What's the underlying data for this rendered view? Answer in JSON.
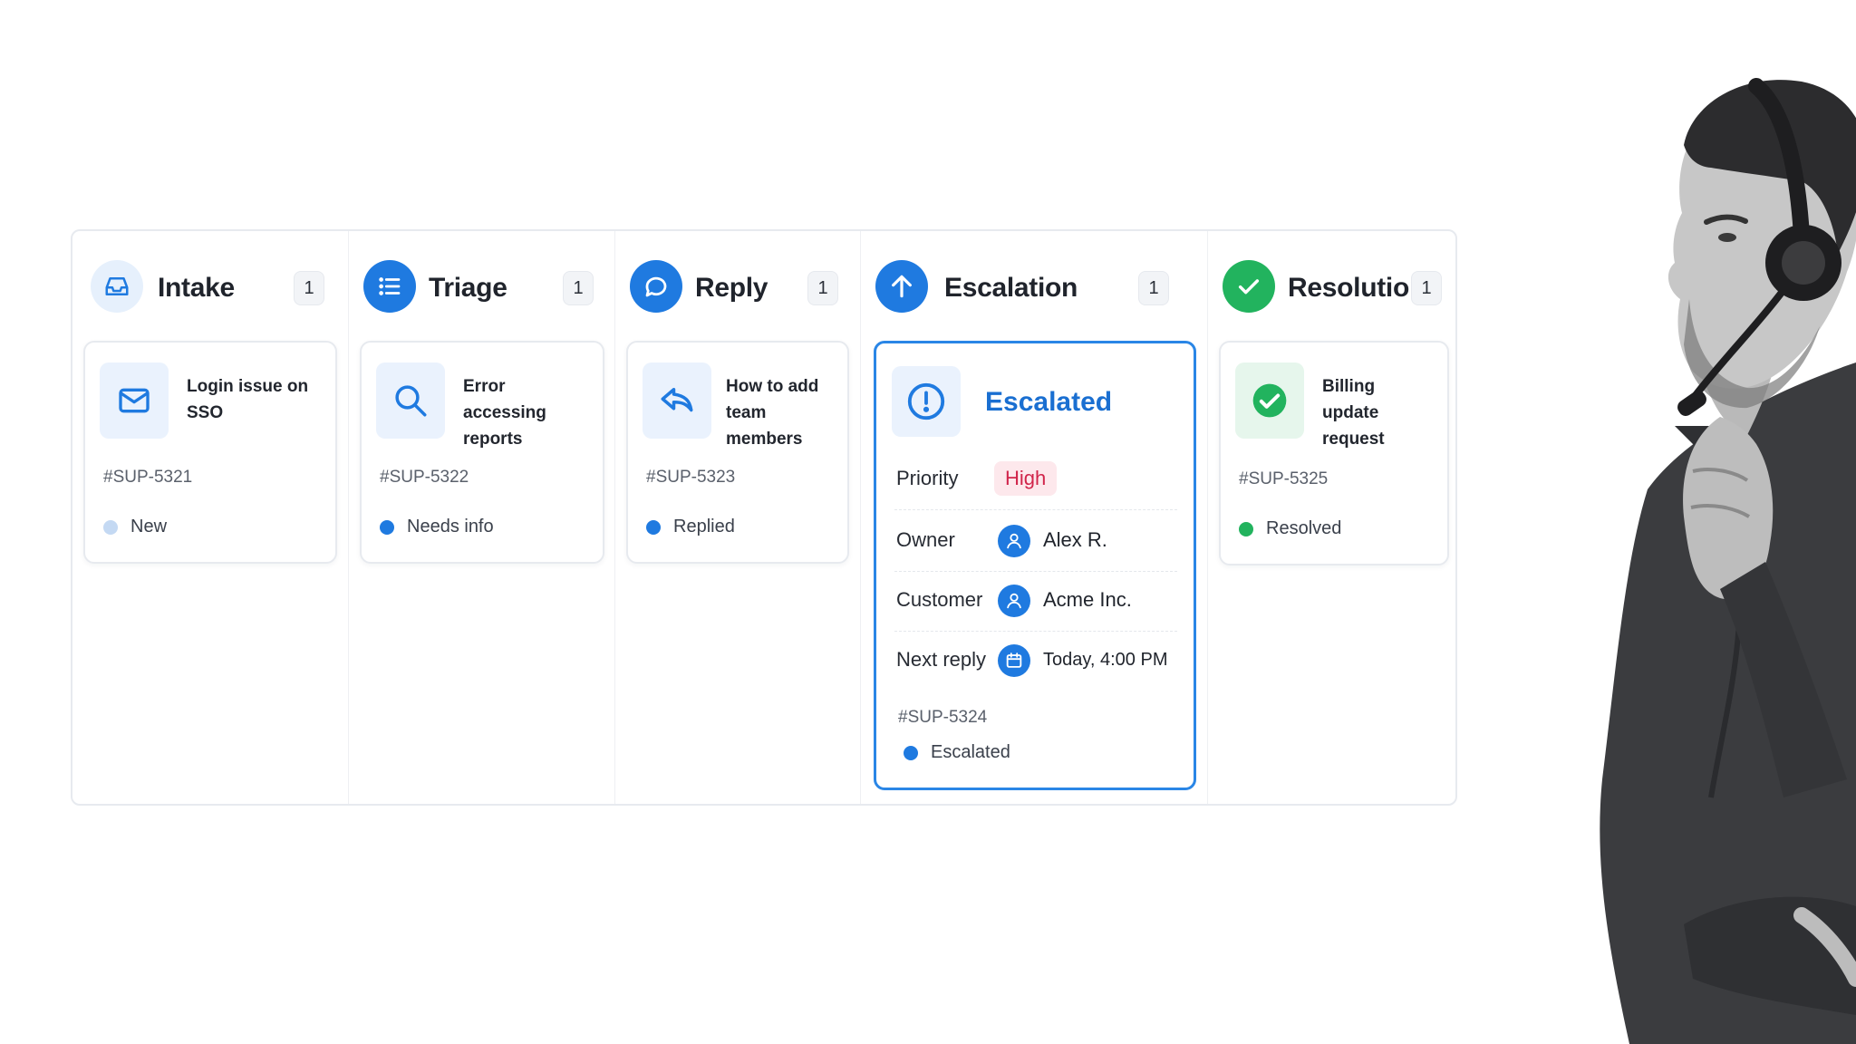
{
  "columns": [
    {
      "title": "Intake",
      "count": "1",
      "icon": "inbox-icon",
      "card": {
        "title": "Login issue on SSO",
        "icon": "mail-icon",
        "id": "#SUP-5321",
        "status": "New",
        "status_color": "#c4d9f3"
      }
    },
    {
      "title": "Triage",
      "count": "1",
      "icon": "list-icon",
      "card": {
        "title": "Error accessing reports",
        "icon": "search-icon",
        "id": "#SUP-5322",
        "status": "Needs info",
        "status_color": "#1f7ae0"
      }
    },
    {
      "title": "Reply",
      "count": "1",
      "icon": "chat-bubble-icon",
      "card": {
        "title": "How to add team members",
        "icon": "reply-icon",
        "id": "#SUP-5323",
        "status": "Replied",
        "status_color": "#1f7ae0"
      }
    },
    {
      "title": "Escalation",
      "count": "1",
      "icon": "arrow-up-icon"
    },
    {
      "title": "Resolution",
      "count": "1",
      "icon": "check-icon",
      "card": {
        "title": "Billing update request",
        "icon": "check-circle-icon",
        "id": "#SUP-5325",
        "status": "Resolved",
        "status_color": "#22b35e"
      }
    }
  ],
  "escalation_card": {
    "title": "Escalated",
    "icon": "alert-circle-icon",
    "priority_label": "Priority",
    "priority_value": "High",
    "owner_label": "Owner",
    "owner_value": "Alex R.",
    "customer_label": "Customer",
    "customer_value": "Acme Inc.",
    "next_reply_label": "Next reply",
    "next_reply_value": "Today, 4:00 PM",
    "id": "#SUP-5324",
    "status": "Escalated",
    "status_color": "#1f7ae0"
  },
  "colors": {
    "accent": "#1f7ae0",
    "success": "#22b35e",
    "high": "#d1244a"
  }
}
